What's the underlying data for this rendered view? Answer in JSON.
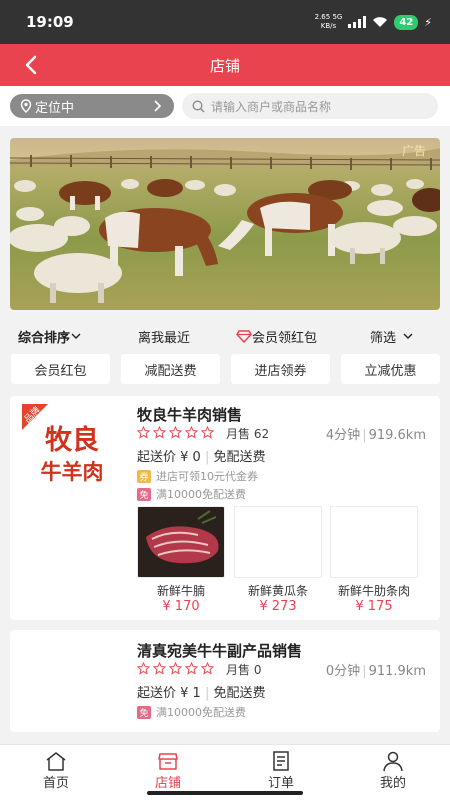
{
  "status": {
    "time": "19:09",
    "net_speed": "2.65",
    "net_unit": "KB/s",
    "net_type": "5G",
    "battery": "42"
  },
  "header": {
    "title": "店铺"
  },
  "location": {
    "label": "定位中"
  },
  "search": {
    "placeholder": "请输入商户或商品名称"
  },
  "banner": {
    "tag": "广告"
  },
  "sort": {
    "comprehensive": "综合排序",
    "nearest": "离我最近",
    "member_redpacket": "会员领红包",
    "filter": "筛选"
  },
  "chips": [
    "会员红包",
    "减配送费",
    "进店领券",
    "立减优惠"
  ],
  "shops": [
    {
      "name": "牧良牛羊肉销售",
      "logo_line1": "牧良",
      "logo_line2": "牛羊肉",
      "logo_tag": "品牌",
      "monthly_sales": "月售 62",
      "time": "4分钟",
      "distance": "919.6km",
      "min_order": "起送价 ¥ 0",
      "delivery": "免配送费",
      "coupon_badge": "券",
      "coupon_text": "进店可领10元代金券",
      "free_badge": "免",
      "free_text": "满10000免配送费",
      "products": [
        {
          "name": "新鲜牛腩",
          "price": "¥ 170"
        },
        {
          "name": "新鲜黄瓜条",
          "price": "¥ 273"
        },
        {
          "name": "新鲜牛肋条肉",
          "price": "¥ 175"
        }
      ]
    },
    {
      "name": "清真宛美牛牛副产品销售",
      "monthly_sales": "月售 0",
      "time": "0分钟",
      "distance": "911.9km",
      "min_order": "起送价 ¥ 1",
      "delivery": "免配送费",
      "free_badge": "免",
      "free_text": "满10000免配送费"
    }
  ],
  "tabs": [
    {
      "label": "首页",
      "icon": "home-icon"
    },
    {
      "label": "店铺",
      "icon": "shop-icon",
      "active": true
    },
    {
      "label": "订单",
      "icon": "order-icon"
    },
    {
      "label": "我的",
      "icon": "profile-icon"
    }
  ],
  "colors": {
    "primary": "#e8434f",
    "status_bar": "#333333",
    "battery": "#2ecc71"
  }
}
